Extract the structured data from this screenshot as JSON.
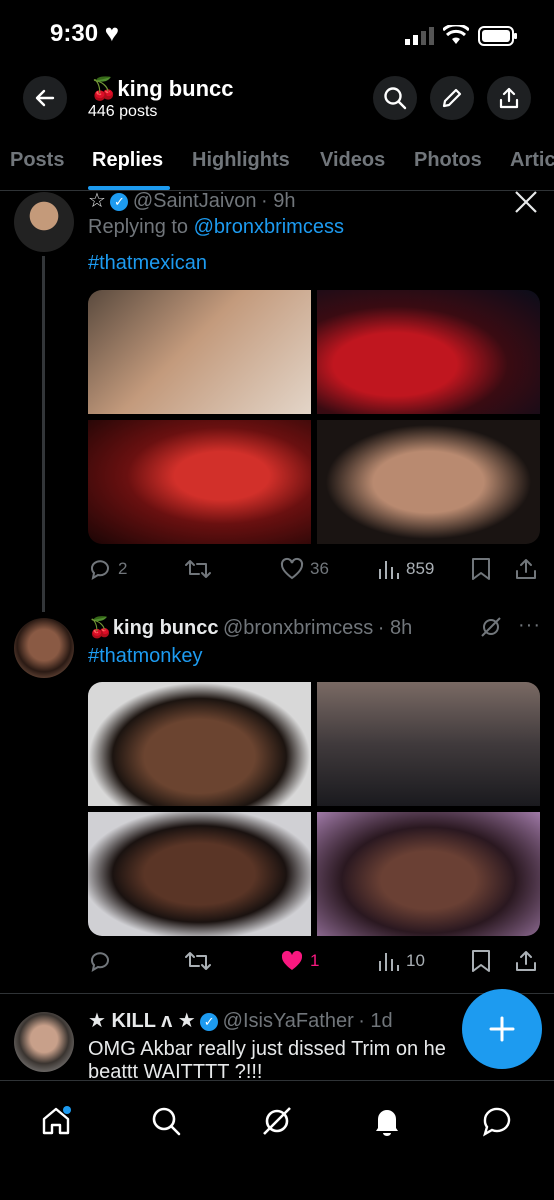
{
  "status_bar": {
    "time": "9:30"
  },
  "header": {
    "title": "king buncc",
    "title_emoji": "🍒",
    "posts_count": "446 posts"
  },
  "tabs": [
    {
      "label": "Posts"
    },
    {
      "label": "Replies"
    },
    {
      "label": "Highlights"
    },
    {
      "label": "Videos"
    },
    {
      "label": "Photos"
    },
    {
      "label": "Artic"
    }
  ],
  "posts": [
    {
      "author_prefix": "☆",
      "handle": "@SaintJaivon",
      "time": "· 9h",
      "replying_prefix": "Replying to ",
      "replying_to": "@bronxbrimcess",
      "hashtag": "#thatmexican",
      "replies": "2",
      "reposts": "",
      "likes": "36",
      "views": "859"
    },
    {
      "name": "king buncc",
      "name_emoji": "🍒",
      "handle": "@bronxbrimcess",
      "time": "· 8h",
      "hashtag": "#thatmonkey",
      "replies": "",
      "reposts": "",
      "likes": "1",
      "views": "10"
    },
    {
      "name": "★ KILL ʌ ★",
      "handle": "@IsisYaFather",
      "time": "· 1d",
      "text_line1": "OMG Akbar really just dissed Trim on he",
      "text_line2": "beattt WAITTTT ?!!!"
    }
  ],
  "colors": {
    "accent": "#1d9bf0",
    "like_active": "#f91880",
    "muted": "#71767b"
  }
}
